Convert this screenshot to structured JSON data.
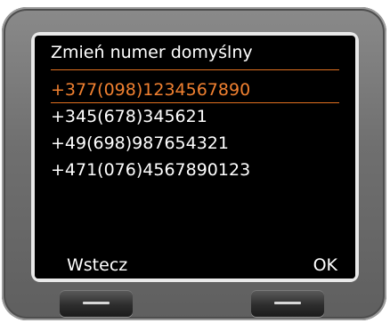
{
  "screen": {
    "title": "Zmień numer domyślny",
    "numbers": [
      "+377(098)1234567890",
      "+345(678)345621",
      "+49(698)987654321",
      "+471(076)4567890123"
    ]
  },
  "softkeys": {
    "left_label": "Wstecz",
    "right_label": "OK"
  },
  "colors": {
    "highlight": "#f08030",
    "screen_background": "#000000",
    "text": "#ffffff"
  }
}
